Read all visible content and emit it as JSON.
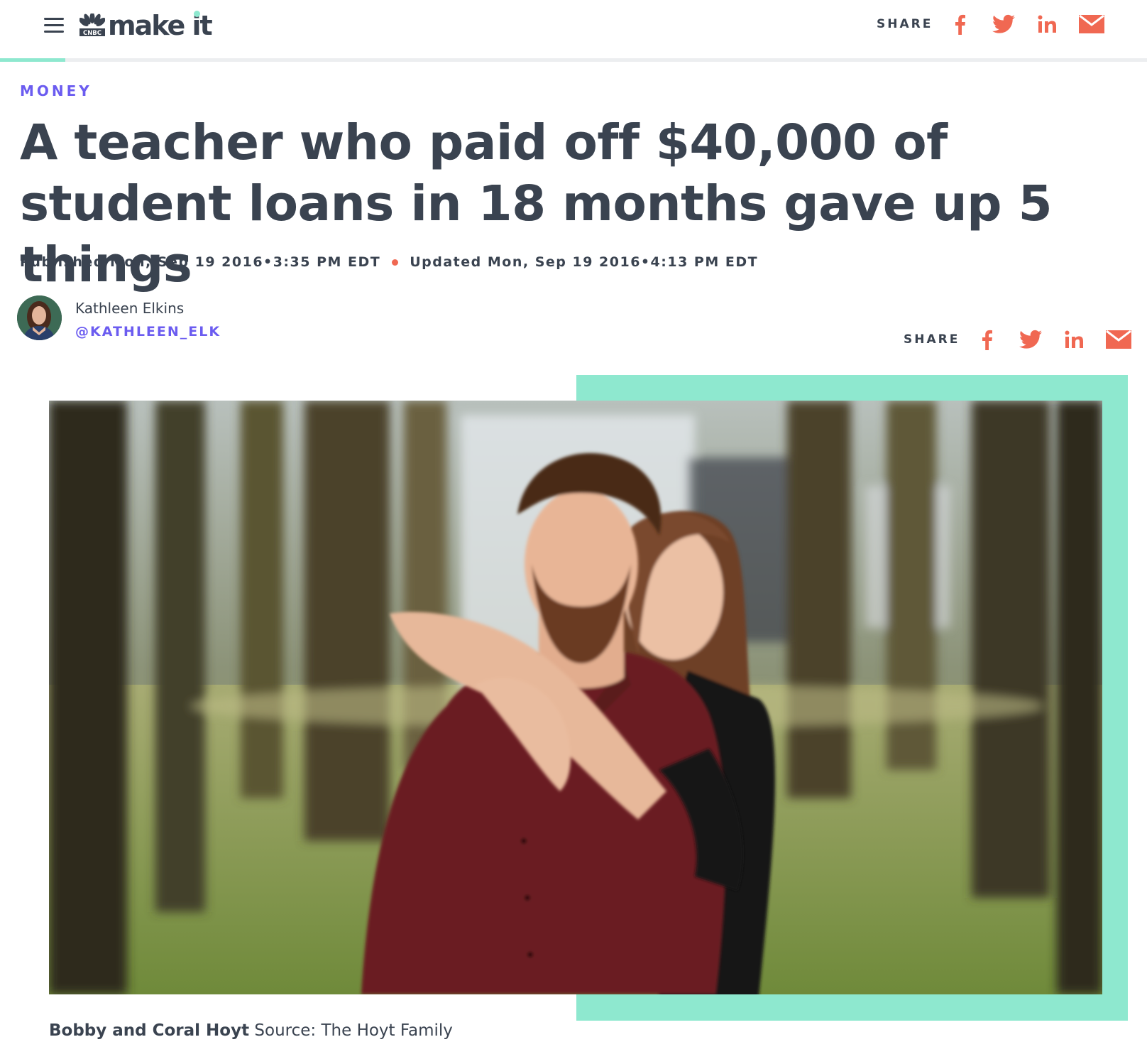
{
  "header": {
    "brand_network": "CNBC",
    "brand_name": "make it",
    "share_label": "SHARE",
    "reading_progress": 0.057
  },
  "share_icons": [
    "facebook-icon",
    "twitter-icon",
    "linkedin-icon",
    "email-icon"
  ],
  "colors": {
    "accent_purple": "#6b5cf0",
    "accent_coral": "#f06852",
    "accent_mint": "#8ee8cf",
    "text_dark": "#3a4350"
  },
  "article": {
    "section": "MONEY",
    "title": "A teacher who paid off $40,000 of student loans in 18 months gave up 5 things",
    "published": "Published Mon, Sep 19 2016•3:35 PM EDT",
    "updated": "Updated Mon, Sep 19 2016•4:13 PM EDT",
    "author": {
      "name": "Kathleen Elkins",
      "handle": "@KATHLEEN_ELK"
    },
    "share_label": "SHARE",
    "image_caption": {
      "subject": "Bobby and Coral Hoyt",
      "source": "Source: The Hoyt Family"
    }
  }
}
